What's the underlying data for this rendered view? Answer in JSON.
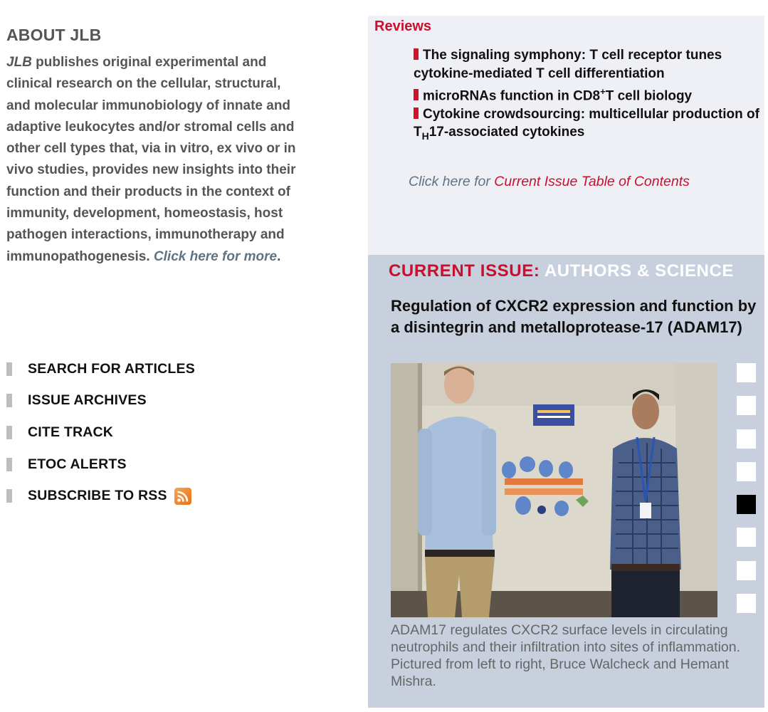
{
  "about": {
    "title": "ABOUT JLB",
    "journal": "JLB",
    "text": " publishes original experimental and clinical research on the cellular, structural, and molecular immunobiology of innate and adaptive leukocytes and/or stromal cells and other cell types that, via in vitro, ex vivo or in vivo studies, provides new insights into their function and their products in the context of immunity, development, homeostasis, host pathogen interactions, immunotherapy and immunopathogenesis. ",
    "more_link": "Click here for more",
    "more_tail": "."
  },
  "nav": {
    "items": [
      {
        "label": "SEARCH FOR ARTICLES"
      },
      {
        "label": "ISSUE ARCHIVES"
      },
      {
        "label": "CITE TRACK"
      },
      {
        "label": "ETOC ALERTS"
      },
      {
        "label": "SUBSCRIBE TO RSS",
        "icon": "rss-icon"
      }
    ]
  },
  "reviews": {
    "title": "Reviews",
    "items": [
      {
        "text": "The signaling symphony: T cell receptor tunes cytokine-mediated T cell differentiation"
      },
      {
        "pre": "microRNAs function in CD8",
        "sup": "+",
        "post": "T cell biology"
      },
      {
        "pre": "Cytokine crowdsourcing: multicellular production of T",
        "sub": "H",
        "post": "17-associated cytokines"
      }
    ],
    "toc_prefix": "Click here for ",
    "toc_link": "Current Issue Table of Contents"
  },
  "current_issue": {
    "label_red": "CURRENT ISSUE:",
    "label_white": "AUTHORS & SCIENCE",
    "title": "Regulation of CXCR2 expression and function by a disintegrin and metalloprotease-17 (ADAM17)",
    "caption": "ADAM17 regulates CXCR2 surface levels in circulating neutrophils and their infiltration into sites of inflammation. Pictured from left to right, Bruce Walcheck and Hemant Mishra.",
    "slide_count": 8,
    "active_slide": 5
  },
  "colors": {
    "accent_red": "#c8102e",
    "panel_light": "#eef0f6",
    "panel_blue": "#c8d0de",
    "gray_text": "#555555",
    "link_gray": "#5f7384"
  }
}
